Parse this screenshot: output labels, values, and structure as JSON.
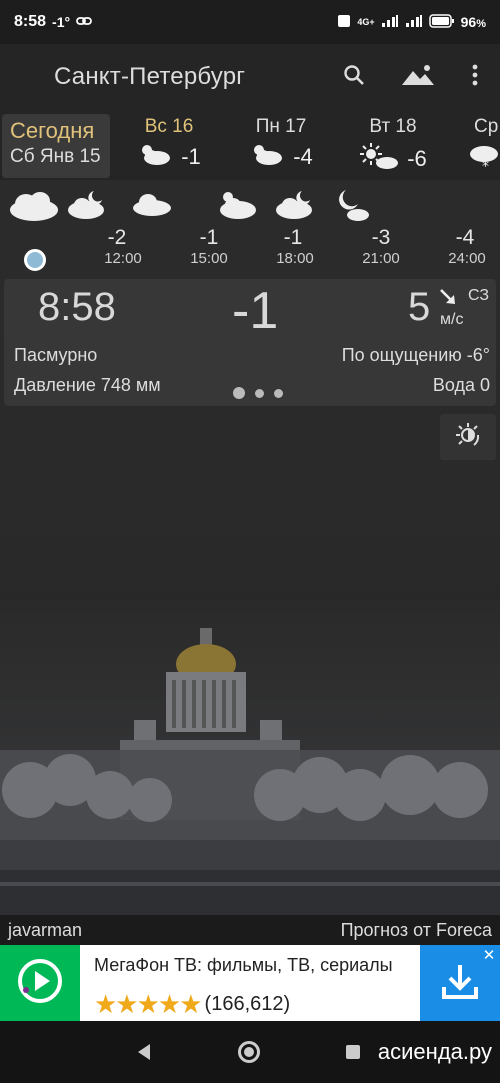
{
  "status_bar": {
    "time": "8:58",
    "temp": "-1°",
    "battery": "96",
    "battery_unit": "%",
    "network": "4G+"
  },
  "app_bar": {
    "city": "Санкт-Петербург",
    "icons": [
      "search-icon",
      "landscape-icon",
      "more-vertical-icon"
    ]
  },
  "days": {
    "today_label": "Сегодня",
    "today_date": "Сб Янв 15",
    "items": [
      {
        "name": "Вс 16",
        "temp": "-1",
        "icon": "cloud-sun-icon"
      },
      {
        "name": "Пн 17",
        "temp": "-4",
        "icon": "cloud-sun-icon"
      },
      {
        "name": "Вт 18",
        "temp": "-6",
        "icon": "sun-cloud-icon"
      },
      {
        "name": "Ср",
        "temp": "",
        "icon": "snow-cloud-icon"
      }
    ]
  },
  "hourly": [
    {
      "temp": "-2",
      "time": "12:00"
    },
    {
      "temp": "-1",
      "time": "15:00"
    },
    {
      "temp": "-1",
      "time": "18:00"
    },
    {
      "temp": "-3",
      "time": "21:00"
    },
    {
      "temp": "-4",
      "time": "24:00"
    }
  ],
  "current": {
    "time": "8:58",
    "temp": "-1",
    "wind_speed": "5",
    "wind_unit": "м/с",
    "wind_dir": "СЗ",
    "condition": "Пасмурно",
    "feels_like": "По ощущению -6°",
    "pressure": "Давление 748 мм",
    "water": "Вода 0"
  },
  "footer": {
    "photo_author": "javarman",
    "credit": "Прогноз от Foreca"
  },
  "ad": {
    "title": "МегаФон ТВ: фильмы, ТВ, сериалы",
    "rating_count": "(166,612)",
    "stars": "★★★★★",
    "close": "✕"
  },
  "watermark": "асиенда.ру",
  "colors": {
    "accent_today": "#e0c27a",
    "ad_green": "#00b956",
    "ad_blue": "#1a8ee6"
  }
}
